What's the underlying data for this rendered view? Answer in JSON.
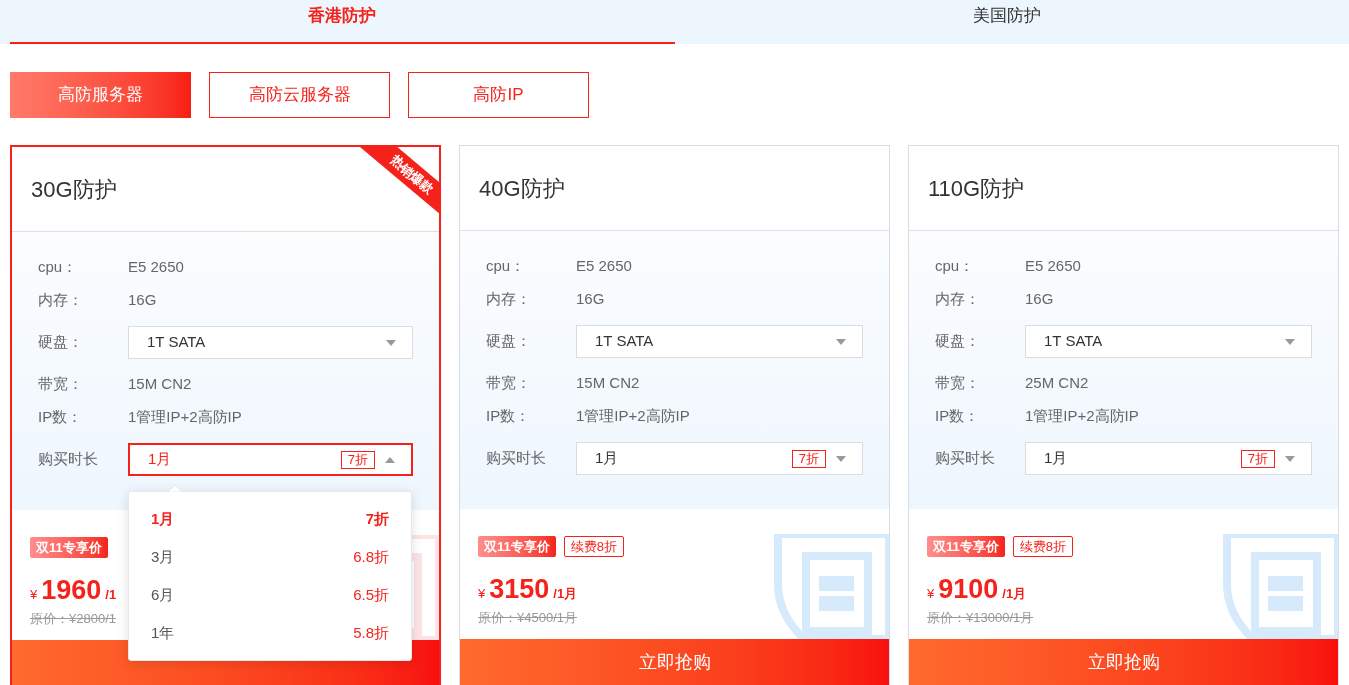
{
  "tabs": [
    {
      "label": "香港防护",
      "selected": true
    },
    {
      "label": "美国防护",
      "selected": false
    }
  ],
  "categories": [
    {
      "label": "高防服务器",
      "selected": true
    },
    {
      "label": "高防云服务器",
      "selected": false
    },
    {
      "label": "高防IP",
      "selected": false
    }
  ],
  "cards": [
    {
      "title": "30G防护",
      "selected": true,
      "ribbon": "热销爆款",
      "specs": [
        {
          "kind": "text",
          "label": "cpu：",
          "value": "E5 2650"
        },
        {
          "kind": "text",
          "label": "内存：",
          "value": "16G"
        },
        {
          "kind": "select",
          "label": "硬盘：",
          "value": "1T SATA",
          "expanded": false
        },
        {
          "kind": "text",
          "label": "带宽：",
          "value": "15M CN2"
        },
        {
          "kind": "text",
          "label": "IP数：",
          "value": "1管理IP+2高防IP"
        },
        {
          "kind": "select",
          "label": "购买时长",
          "value": "1月",
          "badge": "7折",
          "expanded": true,
          "options": [
            {
              "label": "1月",
              "discount": "7折",
              "selected": true
            },
            {
              "label": "3月",
              "discount": "6.8折",
              "selected": false
            },
            {
              "label": "6月",
              "discount": "6.5折",
              "selected": false
            },
            {
              "label": "1年",
              "discount": "5.8折",
              "selected": false
            }
          ]
        }
      ],
      "promo": "双11专享价",
      "currency": "¥",
      "price": "1960",
      "unit": "/1",
      "original": "原价：¥2800/1"
    },
    {
      "title": "40G防护",
      "selected": false,
      "specs": [
        {
          "kind": "text",
          "label": "cpu：",
          "value": "E5 2650"
        },
        {
          "kind": "text",
          "label": "内存：",
          "value": "16G"
        },
        {
          "kind": "select",
          "label": "硬盘：",
          "value": "1T SATA",
          "expanded": false
        },
        {
          "kind": "text",
          "label": "带宽：",
          "value": "15M CN2"
        },
        {
          "kind": "text",
          "label": "IP数：",
          "value": "1管理IP+2高防IP"
        },
        {
          "kind": "select",
          "label": "购买时长",
          "value": "1月",
          "badge": "7折",
          "expanded": false
        }
      ],
      "promo": "双11专享价",
      "renew": "续费8折",
      "currency": "¥",
      "price": "3150",
      "unit": "/1月",
      "original": "原价：¥4500/1月",
      "buy": "立即抢购"
    },
    {
      "title": "110G防护",
      "selected": false,
      "specs": [
        {
          "kind": "text",
          "label": "cpu：",
          "value": "E5 2650"
        },
        {
          "kind": "text",
          "label": "内存：",
          "value": "16G"
        },
        {
          "kind": "select",
          "label": "硬盘：",
          "value": "1T SATA",
          "expanded": false
        },
        {
          "kind": "text",
          "label": "带宽：",
          "value": "25M CN2"
        },
        {
          "kind": "text",
          "label": "IP数：",
          "value": "1管理IP+2高防IP"
        },
        {
          "kind": "select",
          "label": "购买时长",
          "value": "1月",
          "badge": "7折",
          "expanded": false
        }
      ],
      "promo": "双11专享价",
      "renew": "续费8折",
      "currency": "¥",
      "price": "9100",
      "unit": "/1月",
      "original": "原价：¥13000/1月",
      "buy": "立即抢购"
    }
  ]
}
